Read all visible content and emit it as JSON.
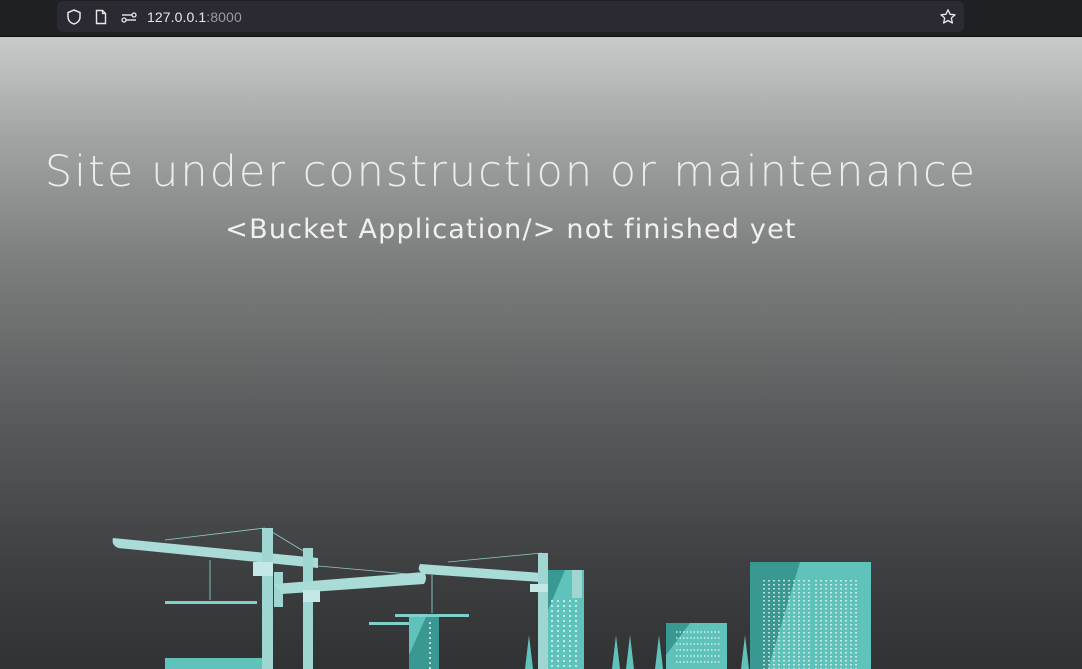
{
  "browser": {
    "url_host": "127.0.0.1",
    "url_port": ":8000"
  },
  "page": {
    "title": "Site under construction or maintenance",
    "subtitle": "<Bucket Application/> not finished yet"
  },
  "colors": {
    "teal": "#5fc2bb",
    "teal_dark": "#3a9892",
    "teal_light": "#a9dbd7"
  },
  "icons": [
    "shield-icon",
    "page-icon",
    "permissions-icon",
    "bookmark-star-icon"
  ]
}
